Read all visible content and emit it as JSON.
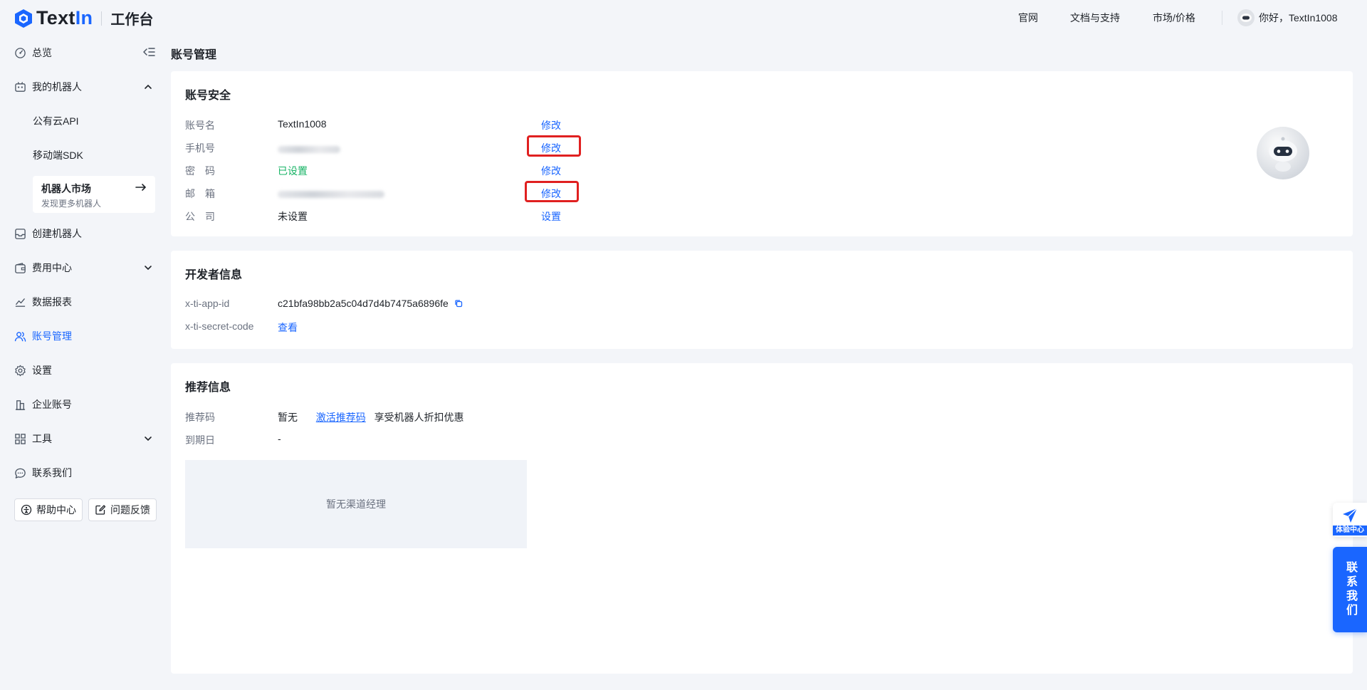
{
  "header": {
    "brand_text": "TextIn",
    "brand_sub": "工作台",
    "nav": [
      "官网",
      "文档与支持",
      "市场/价格"
    ],
    "greeting": "你好，TextIn1008"
  },
  "sidebar": {
    "overview": "总览",
    "my_robots": "我的机器人",
    "public_api": "公有云API",
    "mobile_sdk": "移动端SDK",
    "market_title": "机器人市场",
    "market_desc": "发现更多机器人",
    "create_robot": "创建机器人",
    "billing": "费用中心",
    "reports": "数据报表",
    "account": "账号管理",
    "settings": "设置",
    "enterprise": "企业账号",
    "tools": "工具",
    "contact": "联系我们",
    "help_center": "帮助中心",
    "feedback": "问题反馈"
  },
  "page": {
    "title": "账号管理"
  },
  "security": {
    "title": "账号安全",
    "rows": [
      {
        "label": "账号名",
        "value": "TextIn1008",
        "action": "修改"
      },
      {
        "label": "手机号",
        "value": "",
        "action": "修改"
      },
      {
        "label": "密　码",
        "value": "已设置",
        "action": "修改"
      },
      {
        "label": "邮　箱",
        "value": "",
        "action": "修改"
      },
      {
        "label": "公　司",
        "value": "未设置",
        "action": "设置"
      }
    ]
  },
  "developer": {
    "title": "开发者信息",
    "app_id_label": "x-ti-app-id",
    "app_id_value": "c21bfa98bb2a5c04d7d4b7475a6896fe",
    "secret_label": "x-ti-secret-code",
    "secret_action": "查看"
  },
  "referral": {
    "title": "推荐信息",
    "code_label": "推荐码",
    "code_value": "暂无",
    "activate_link": "激活推荐码",
    "benefit_text": "享受机器人折扣优惠",
    "expire_label": "到期日",
    "expire_value": "-",
    "manager_empty": "暂无渠道经理"
  },
  "floating": {
    "experience": "体验中心",
    "contact": "联系我们"
  },
  "colors": {
    "primary": "#1a66ff",
    "success": "#16b364",
    "highlight": "#e02020",
    "background": "#f3f5f9"
  }
}
